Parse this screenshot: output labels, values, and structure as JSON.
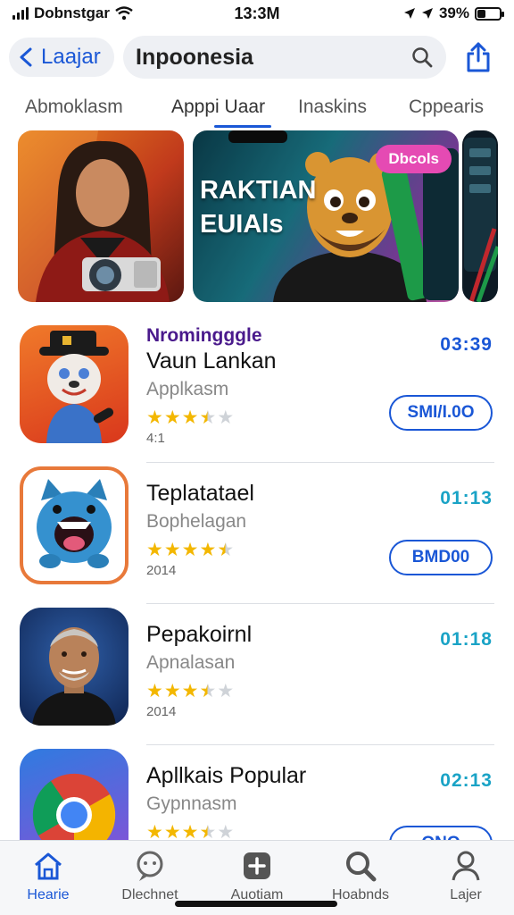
{
  "status_bar": {
    "carrier": "Dobnstgar",
    "time": "13:3M",
    "battery": "39%",
    "battery_level": 0.39
  },
  "nav": {
    "back_label": "Laajar",
    "search_value": "Inpoonesia"
  },
  "tabs": [
    {
      "label": "Abmoklasm"
    },
    {
      "label": "Apppi Uaar",
      "active": true
    },
    {
      "label": "Inaskins"
    },
    {
      "label": "Cppearis"
    }
  ],
  "banners": {
    "second_title_line1": "RAKTIAN",
    "second_title_line2": "EUIAls",
    "badge": "Dbcols"
  },
  "apps": [
    {
      "eyebrow": "Nromingggle",
      "name": "Vaun Lankan",
      "category": "Applkasm",
      "rating": 3.5,
      "year": "4:1",
      "time": "03:39",
      "button": "SMI/I.0O"
    },
    {
      "eyebrow": "",
      "name": "Teplatatael",
      "category": "Bophelagan",
      "rating": 4.5,
      "year": "2014",
      "time": "01:13",
      "button": "BMD00"
    },
    {
      "eyebrow": "",
      "name": "Pepakoirnl",
      "category": "Apnalasan",
      "rating": 3.5,
      "year": "2014",
      "time": "01:18",
      "button": ""
    },
    {
      "eyebrow": "",
      "name": "Apllkais Popular",
      "category": "Gypnnasm",
      "rating": 3.5,
      "year": "",
      "time": "02:13",
      "button": "ONO"
    }
  ],
  "tab_bar": [
    {
      "label": "Hearie",
      "icon": "home-icon",
      "active": true
    },
    {
      "label": "Dlechnet",
      "icon": "chat-icon"
    },
    {
      "label": "Auotiam",
      "icon": "plus-icon"
    },
    {
      "label": "Hoabnds",
      "icon": "search-icon"
    },
    {
      "label": "Lajer",
      "icon": "person-icon"
    }
  ],
  "colors": {
    "accent": "#1a57d6",
    "time_cyan": "#1aa3c6",
    "star": "#f3b700",
    "badge_pink": "#e54ab3"
  }
}
